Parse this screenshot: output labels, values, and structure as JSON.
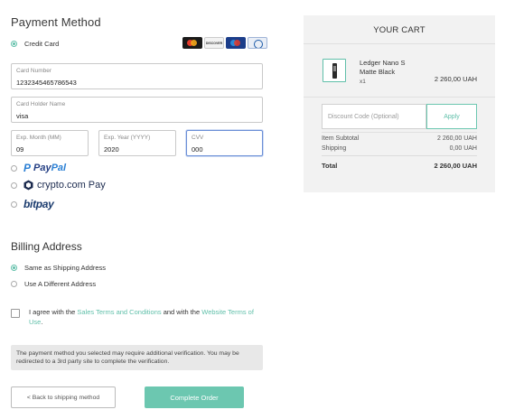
{
  "payment": {
    "title": "Payment Method",
    "credit_card_label": "Credit Card",
    "card_brands": [
      "mastercard-icon",
      "discover-icon",
      "maestro-icon",
      "diners-club-icon"
    ],
    "fields": {
      "card_number": {
        "label": "Card Number",
        "value": "1232345465786543"
      },
      "holder_name": {
        "label": "Card Holder Name",
        "value": "visa"
      },
      "exp_month": {
        "label": "Exp. Month (MM)",
        "value": "09"
      },
      "exp_year": {
        "label": "Exp. Year (YYYY)",
        "value": "2020"
      },
      "cvv": {
        "label": "CVV",
        "value": "000"
      }
    },
    "paypal_1": "Pay",
    "paypal_2": "Pal",
    "crypto_name": "crypto.com",
    "crypto_pay": "Pay",
    "bitpay": "bitpay"
  },
  "billing": {
    "title": "Billing Address",
    "options": [
      "Same as Shipping Address",
      "Use A Different Address"
    ],
    "selected": 0
  },
  "agree": {
    "prefix": "I agree with the ",
    "link1": "Sales Terms and Conditions",
    "middle": " and with the ",
    "link2": "Website Terms of Use",
    "suffix": "."
  },
  "notice": "The payment method you selected may require additional verification. You may be redirected to a 3rd party site to complete the verification.",
  "buttons": {
    "back": "< Back to shipping method",
    "complete": "Complete Order"
  },
  "cart": {
    "title": "YOUR CART",
    "product_name_1": "Ledger Nano S",
    "product_name_2": "Matte Black",
    "qty": "x1",
    "price": "2 260,00 UAH",
    "discount_placeholder": "Discount Code (Optional)",
    "apply": "Apply",
    "subtotal_label": "Item Subtotal",
    "subtotal_value": "2 260,00 UAH",
    "shipping_label": "Shipping",
    "shipping_value": "0,00 UAH",
    "total_label": "Total",
    "total_value": "2 260,00 UAH"
  },
  "colors": {
    "accent": "#5fbfa9",
    "button": "#6cc7b0",
    "panel": "#f2f2f2"
  }
}
